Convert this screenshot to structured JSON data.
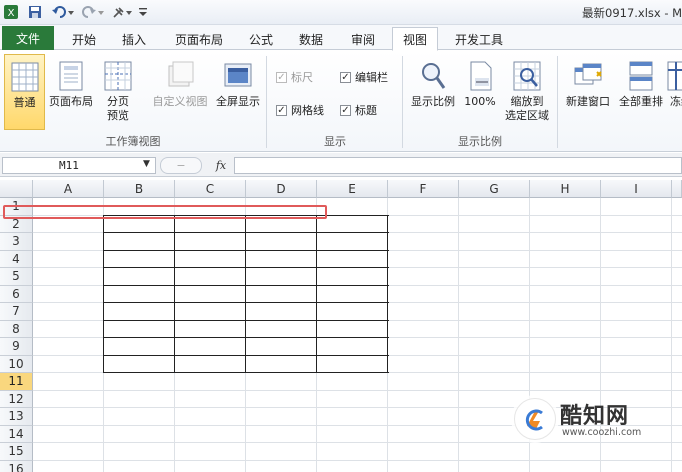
{
  "titlebar": {
    "title": "最新0917.xlsx - M"
  },
  "tabs": [
    {
      "label": "文件"
    },
    {
      "label": "开始"
    },
    {
      "label": "插入"
    },
    {
      "label": "页面布局"
    },
    {
      "label": "公式"
    },
    {
      "label": "数据"
    },
    {
      "label": "审阅"
    },
    {
      "label": "视图"
    },
    {
      "label": "开发工具"
    }
  ],
  "active_tab": "视图",
  "ribbon": {
    "workbook_views": {
      "group_label": "工作簿视图",
      "normal": "普通",
      "page_layout": "页面布局",
      "page_break_1": "分页",
      "page_break_2": "预览",
      "custom_views": "自定义视图",
      "full_screen": "全屏显示"
    },
    "show": {
      "group_label": "显示",
      "ruler": "标尺",
      "formula_bar": "编辑栏",
      "gridlines": "网格线",
      "headings": "标题",
      "ruler_checked": true,
      "formula_bar_checked": true,
      "gridlines_checked": true,
      "headings_checked": true
    },
    "zoom": {
      "group_label": "显示比例",
      "zoom": "显示比例",
      "zoom_100": "100%",
      "zoom_to_selection_1": "缩放到",
      "zoom_to_selection_2": "选定区域"
    },
    "window": {
      "new_window": "新建窗口",
      "arrange_all": "全部重排",
      "freeze": "冻结"
    }
  },
  "formula_bar": {
    "name_box": "M11",
    "fx": "fx",
    "formula": ""
  },
  "columns": [
    "A",
    "B",
    "C",
    "D",
    "E",
    "F",
    "G",
    "H",
    "I"
  ],
  "rows": [
    "1",
    "2",
    "3",
    "4",
    "5",
    "6",
    "7",
    "8",
    "9",
    "10",
    "11",
    "12",
    "13",
    "14",
    "15",
    "16"
  ],
  "selected_row": "11",
  "watermark": {
    "brand": "酷知网",
    "url": "www.coozhi.com"
  },
  "colors": {
    "file_tab": "#2a7a3a",
    "selected_row": "#f9d77e",
    "highlight_box": "#e05a5a"
  }
}
